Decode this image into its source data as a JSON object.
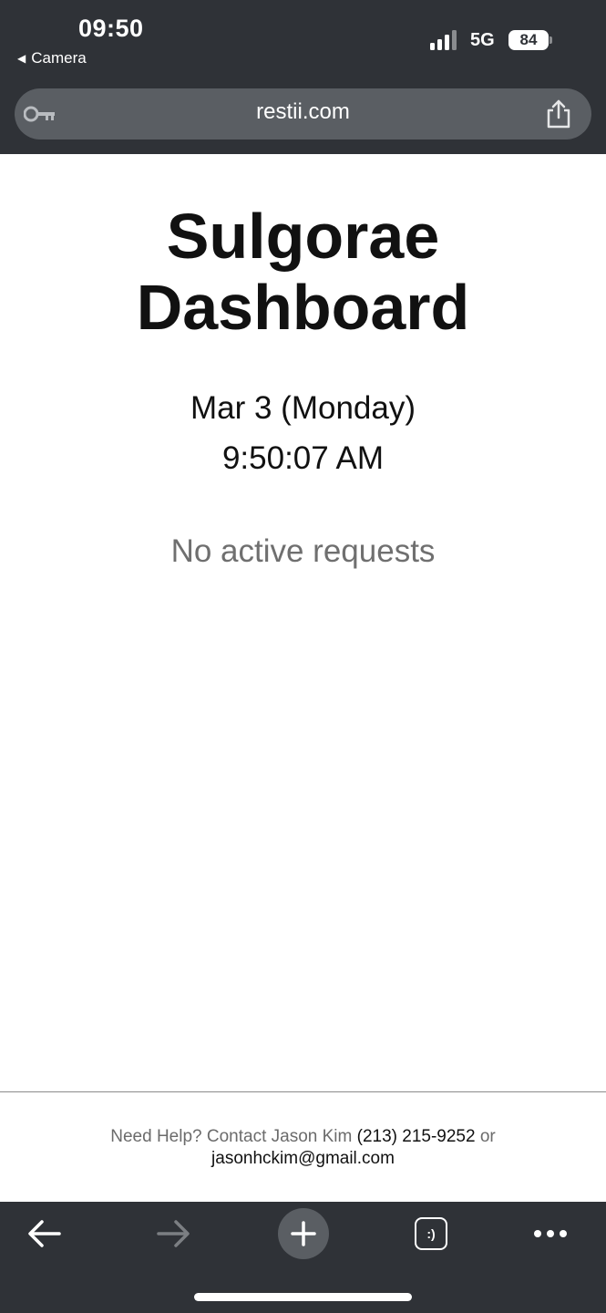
{
  "status_bar": {
    "time": "09:50",
    "back_app": "Camera",
    "network": "5G",
    "battery": "84"
  },
  "browser": {
    "url": "restii.com",
    "tabs_count_label": ":)"
  },
  "dashboard": {
    "title_line1": "Sulgorae",
    "title_line2": "Dashboard",
    "date": "Mar 3 (Monday)",
    "time": "9:50:07 AM",
    "empty_message": "No active requests"
  },
  "footer": {
    "help_prefix": "Need Help? Contact Jason Kim",
    "phone": "(213) 215-9252",
    "or_text": "or",
    "email": "jasonhckim@gmail.com"
  },
  "icons": {
    "key": "key-icon",
    "share": "share-icon",
    "back": "arrow-left-icon",
    "forward": "arrow-right-icon",
    "add": "plus-icon",
    "tabs": "tabs-icon",
    "more": "more-dots-icon"
  },
  "colors": {
    "chrome_background": "#2f3237",
    "url_bar": "#5a5e63",
    "page_background": "#ffffff",
    "muted_text": "#6f6f6f"
  }
}
